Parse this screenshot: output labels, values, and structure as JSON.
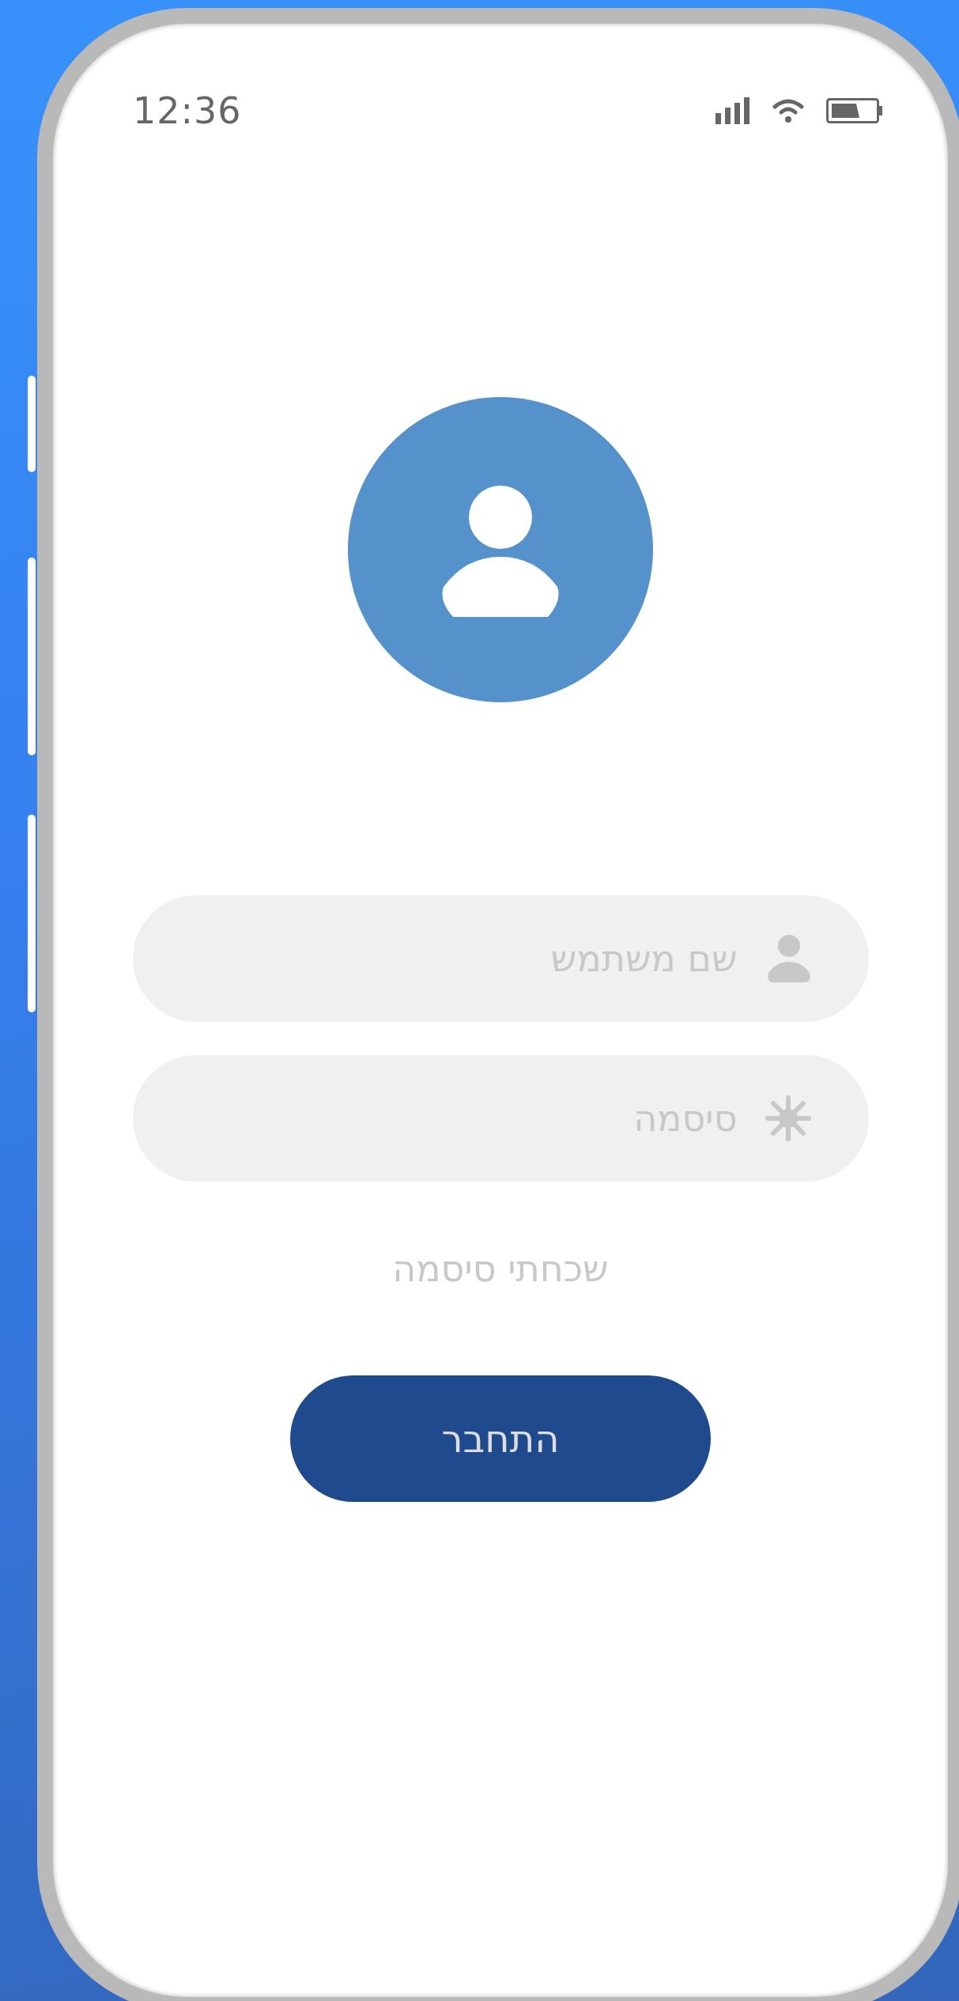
{
  "status_bar": {
    "time": "12:36"
  },
  "fields": [
    {
      "kind": "username",
      "placeholder": "שם משתמש"
    },
    {
      "kind": "password",
      "placeholder": "סיסמה"
    }
  ],
  "forgot_link": "שכחתי סיסמה",
  "login_button": "התחבר"
}
